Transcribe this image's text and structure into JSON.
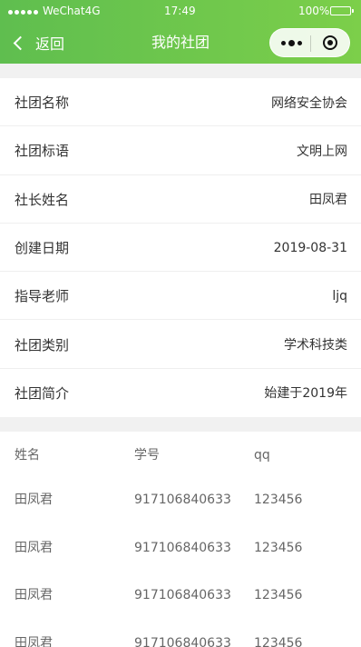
{
  "status_bar": {
    "carrier": "WeChat4G",
    "time": "17:49",
    "battery": "100%"
  },
  "nav": {
    "back_label": "返回",
    "title": "我的社团",
    "more_icon": "more-icon",
    "close_icon": "close-icon"
  },
  "club_info": [
    {
      "label": "社团名称",
      "value": "网络安全协会"
    },
    {
      "label": "社团标语",
      "value": "文明上网"
    },
    {
      "label": "社长姓名",
      "value": "田凤君"
    },
    {
      "label": "创建日期",
      "value": "2019-08-31"
    },
    {
      "label": "指导老师",
      "value": "ljq"
    },
    {
      "label": "社团类别",
      "value": "学术科技类"
    },
    {
      "label": "社团简介",
      "value": "始建于2019年"
    }
  ],
  "members": {
    "headers": [
      "姓名",
      "学号",
      "qq"
    ],
    "rows": [
      [
        "田凤君",
        "917106840633",
        "123456"
      ],
      [
        "田凤君",
        "917106840633",
        "123456"
      ],
      [
        "田凤君",
        "917106840633",
        "123456"
      ],
      [
        "田凤君",
        "917106840633",
        "123456"
      ]
    ]
  },
  "colors": {
    "nav_start": "#5fbe4f",
    "nav_end": "#7ccf4a",
    "background": "#f1f1f1",
    "text": "#333333"
  }
}
